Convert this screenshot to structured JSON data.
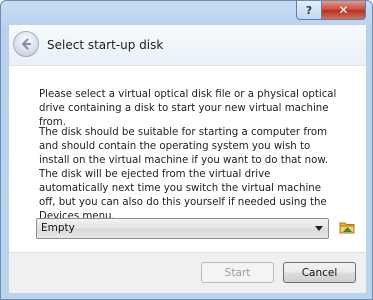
{
  "window": {
    "help_label": "?",
    "close_label": "✕"
  },
  "header": {
    "title": "Select start-up disk",
    "back_icon": "back-arrow-icon"
  },
  "content": {
    "paragraph1": "Please select a virtual optical disk file or a physical optical drive containing a disk to start your new virtual machine from.",
    "paragraph2": "The disk should be suitable for starting a computer from and should contain the operating system you wish to install on the virtual machine if you want to do that now. The disk will be ejected from the virtual drive automatically next time you switch the virtual machine off, but you can also do this yourself if needed using the Devices menu."
  },
  "disk_select": {
    "selected": "Empty",
    "browse_icon": "folder-browse-icon"
  },
  "footer": {
    "start_label": "Start",
    "cancel_label": "Cancel"
  },
  "colors": {
    "title_bar": "#bcd3ee",
    "close_button": "#c7473a",
    "content_bg": "#ffffff",
    "footer_bg": "#f0f0f0"
  }
}
